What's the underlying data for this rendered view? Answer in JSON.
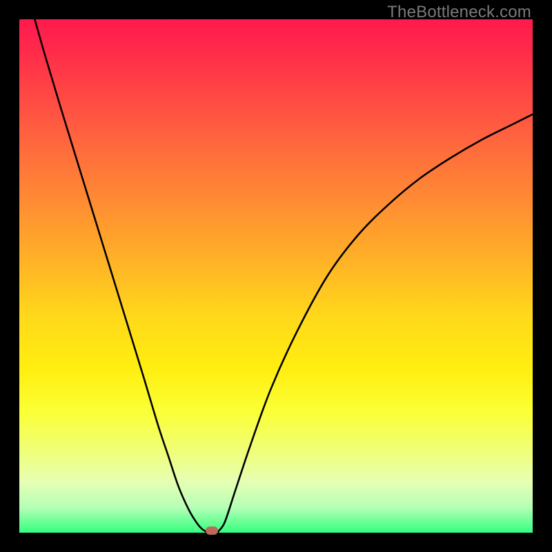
{
  "attribution": "TheBottleneck.com",
  "chart_data": {
    "type": "line",
    "title": "",
    "xlabel": "",
    "ylabel": "",
    "xlim": [
      0,
      100
    ],
    "ylim": [
      0,
      100
    ],
    "grid": false,
    "legend": false,
    "series": [
      {
        "name": "left-branch",
        "x": [
          3.0,
          5,
          8,
          12,
          16,
          20,
          24,
          27,
          29,
          31,
          33,
          34.5,
          35.5,
          36.4
        ],
        "y": [
          100,
          93,
          83,
          70,
          57,
          44,
          31,
          21,
          15,
          9,
          4.5,
          2.0,
          0.8,
          0.2
        ]
      },
      {
        "name": "right-branch",
        "x": [
          38.7,
          40,
          42,
          45,
          49,
          54,
          60,
          66,
          72,
          78,
          84,
          90,
          96,
          100
        ],
        "y": [
          0.2,
          2,
          8,
          17,
          28,
          39,
          50,
          58,
          64,
          69,
          73,
          76.5,
          79.5,
          81.5
        ]
      }
    ],
    "floor_segment": {
      "x": [
        36.4,
        38.7
      ],
      "y": [
        0.0,
        0.0
      ]
    },
    "marker": {
      "x": 37.5,
      "y": 0.4,
      "color": "#bd6a5a"
    },
    "background_gradient": {
      "top": "#ff1a4d",
      "mid": "#ffd91a",
      "bottom": "#33ff80"
    }
  }
}
